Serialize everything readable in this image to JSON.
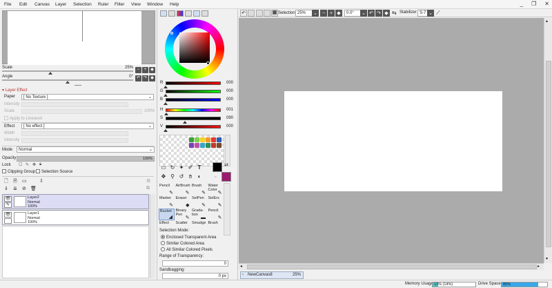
{
  "menu": [
    "File",
    "Edit",
    "Canvas",
    "Layer",
    "Selection",
    "Ruler",
    "Filter",
    "View",
    "Window",
    "Help"
  ],
  "window_controls": [
    "_",
    "❐",
    "✕"
  ],
  "navigator": {
    "scale_label": "Scale",
    "scale_value": "25%",
    "angle_label": "Angle",
    "angle_value": "0°"
  },
  "layer_effect": {
    "header": "Layer Effect",
    "paper_label": "Paper",
    "paper_value": "[ No Texture ]",
    "intensity_label": "Intensity",
    "scale_label": "Scale",
    "scale_value": "100%",
    "apply_linework": "Apply to Linework",
    "effect_label": "Effect",
    "effect_value": "[ No effect ]",
    "width_label": "Width",
    "intensity2_label": "Intensity"
  },
  "layer_props": {
    "mode_label": "Mode",
    "mode_value": "Normal",
    "opacity_label": "Opacity",
    "opacity_value": "100%",
    "opacity_fraction": 1.0,
    "lock_label": "Lock",
    "clipping_group": "Clipping Group",
    "selection_source": "Selection Source"
  },
  "layers": [
    {
      "name": "Layer2",
      "mode": "Normal",
      "opacity": "100%",
      "selected": true
    },
    {
      "name": "Layer1",
      "mode": "Normal",
      "opacity": "100%",
      "selected": false
    }
  ],
  "color": {
    "R": "000",
    "G": "000",
    "B": "000",
    "H": "001",
    "S": "090",
    "V": "000",
    "hue_fraction": 0.01,
    "sat_fraction": 0.35,
    "val_fraction": 0.0,
    "primary": "#000000",
    "secondary": "#9b1b6e",
    "swatches": [
      "#3c9f3c",
      "#7bd34d",
      "#f4d12b",
      "#f59b2c",
      "#e53935",
      "#2b5fb8",
      "#7a3fb5",
      "#c24fa8",
      "#38a7c8",
      "#2f8f5b",
      "#c2382e",
      "#7a4b2a"
    ]
  },
  "tools": [
    {
      "name": "Pencil",
      "glyph": "✎"
    },
    {
      "name": "AirBrush",
      "glyph": "✎"
    },
    {
      "name": "Brush",
      "glyph": "✎"
    },
    {
      "name": "Water Color",
      "glyph": "✎"
    },
    {
      "name": "Marker",
      "glyph": "✎"
    },
    {
      "name": "Eraser",
      "glyph": "◆"
    },
    {
      "name": "SelPen",
      "glyph": "✎"
    },
    {
      "name": "SelErs",
      "glyph": "✎"
    },
    {
      "name": "Bucket",
      "glyph": "◢"
    },
    {
      "name": "Binary Pen",
      "glyph": "✎"
    },
    {
      "name": "Grada-tion",
      "glyph": "▬"
    },
    {
      "name": "Pencil",
      "glyph": "✎"
    },
    {
      "name": "Effect",
      "glyph": ""
    },
    {
      "name": "Scatter",
      "glyph": ""
    },
    {
      "name": "Smudge",
      "glyph": ""
    },
    {
      "name": "Brush",
      "glyph": ""
    }
  ],
  "active_tool_index": 8,
  "bucket": {
    "selection_mode_label": "Selection Mode:",
    "options": [
      "Enclosed Transparent Area",
      "Similar Colored Area",
      "All Similar Colored Pixels"
    ],
    "selected_option": 0,
    "range_label": "Range of Transparency:",
    "range_value": "0",
    "sandbagging_label": "Sandbagging:",
    "sandbagging_value": "0 px"
  },
  "toolbar": {
    "selection_label": "Selection",
    "zoom_value": "25%",
    "angle_value": "0.0°",
    "stabilizer_label": "Stabilizer",
    "stabilizer_value": "S-7"
  },
  "document": {
    "name": "NewCanvas8",
    "zoom": "25%"
  },
  "status": {
    "memory_label": "Memory Usage",
    "memory_text": "13% (14%)",
    "memory_fraction": 0.13,
    "drive_label": "Drive Space",
    "drive_text": "80%",
    "drive_fraction": 0.8
  }
}
